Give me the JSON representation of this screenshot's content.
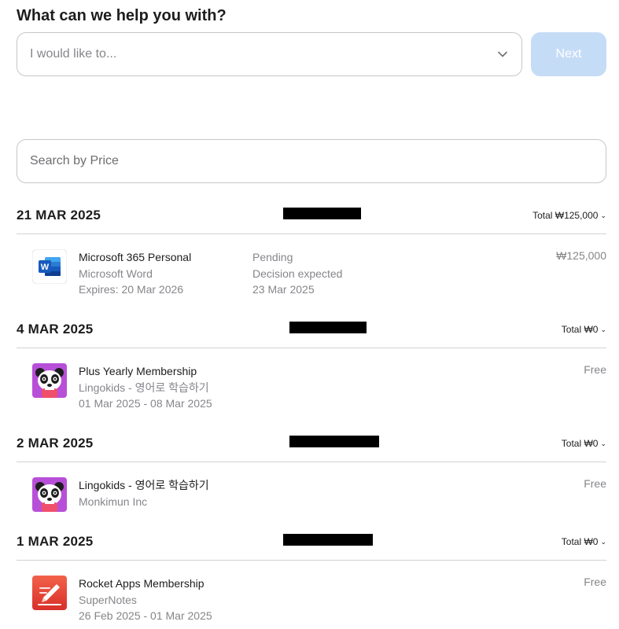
{
  "help": {
    "title": "What can we help you with?",
    "select_placeholder": "I would like to...",
    "next_label": "Next"
  },
  "search": {
    "placeholder": "Search by Price"
  },
  "groups": [
    {
      "date": "21 MAR 2025",
      "total": "Total ₩125,000",
      "items": [
        {
          "name": "Microsoft 365 Personal",
          "publisher": "Microsoft Word",
          "detail": "Expires: 20 Mar 2026",
          "status": "Pending",
          "status_detail": "Decision expected",
          "status_date": "23 Mar 2025",
          "price": "₩125,000",
          "icon": "microsoft-word-icon"
        }
      ]
    },
    {
      "date": "4 MAR 2025",
      "total": "Total ₩0",
      "items": [
        {
          "name": "Plus Yearly Membership",
          "publisher": "Lingokids - 영어로 학습하기",
          "detail": "01 Mar 2025 - 08 Mar 2025",
          "price": "Free",
          "icon": "lingokids-panda-icon"
        }
      ]
    },
    {
      "date": "2 MAR 2025",
      "total": "Total ₩0",
      "items": [
        {
          "name": "Lingokids - 영어로 학습하기",
          "publisher": "Monkimun Inc",
          "price": "Free",
          "icon": "lingokids-panda-icon"
        }
      ]
    },
    {
      "date": "1 MAR 2025",
      "total": "Total ₩0",
      "items": [
        {
          "name": "Rocket Apps Membership",
          "publisher": "SuperNotes",
          "detail": "26 Feb 2025 - 01 Mar 2025",
          "price": "Free",
          "icon": "supernotes-pencil-icon"
        }
      ]
    }
  ],
  "colors": {
    "accent_disabled": "#c5dcf7",
    "secondary_text": "#86868b",
    "divider": "#d2d2d7"
  }
}
